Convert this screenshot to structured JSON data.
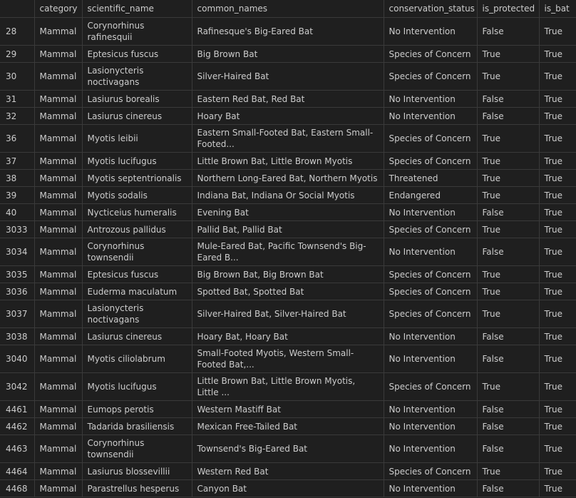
{
  "columns": [
    "",
    "category",
    "scientific_name",
    "common_names",
    "conservation_status",
    "is_protected",
    "is_bat"
  ],
  "rows": [
    {
      "index": "28",
      "category": "Mammal",
      "scientific_name": "Corynorhinus rafinesquii",
      "common_names": "Rafinesque's Big-Eared Bat",
      "conservation_status": "No Intervention",
      "is_protected": "False",
      "is_bat": "True"
    },
    {
      "index": "29",
      "category": "Mammal",
      "scientific_name": "Eptesicus fuscus",
      "common_names": "Big Brown Bat",
      "conservation_status": "Species of Concern",
      "is_protected": "True",
      "is_bat": "True"
    },
    {
      "index": "30",
      "category": "Mammal",
      "scientific_name": "Lasionycteris noctivagans",
      "common_names": "Silver-Haired Bat",
      "conservation_status": "Species of Concern",
      "is_protected": "True",
      "is_bat": "True"
    },
    {
      "index": "31",
      "category": "Mammal",
      "scientific_name": "Lasiurus borealis",
      "common_names": "Eastern Red Bat, Red Bat",
      "conservation_status": "No Intervention",
      "is_protected": "False",
      "is_bat": "True"
    },
    {
      "index": "32",
      "category": "Mammal",
      "scientific_name": "Lasiurus cinereus",
      "common_names": "Hoary Bat",
      "conservation_status": "No Intervention",
      "is_protected": "False",
      "is_bat": "True"
    },
    {
      "index": "36",
      "category": "Mammal",
      "scientific_name": "Myotis leibii",
      "common_names": "Eastern Small-Footed Bat, Eastern Small-Footed...",
      "conservation_status": "Species of Concern",
      "is_protected": "True",
      "is_bat": "True"
    },
    {
      "index": "37",
      "category": "Mammal",
      "scientific_name": "Myotis lucifugus",
      "common_names": "Little Brown Bat, Little Brown Myotis",
      "conservation_status": "Species of Concern",
      "is_protected": "True",
      "is_bat": "True"
    },
    {
      "index": "38",
      "category": "Mammal",
      "scientific_name": "Myotis septentrionalis",
      "common_names": "Northern Long-Eared Bat, Northern Myotis",
      "conservation_status": "Threatened",
      "is_protected": "True",
      "is_bat": "True"
    },
    {
      "index": "39",
      "category": "Mammal",
      "scientific_name": "Myotis sodalis",
      "common_names": "Indiana Bat, Indiana Or Social Myotis",
      "conservation_status": "Endangered",
      "is_protected": "True",
      "is_bat": "True"
    },
    {
      "index": "40",
      "category": "Mammal",
      "scientific_name": "Nycticeius humeralis",
      "common_names": "Evening Bat",
      "conservation_status": "No Intervention",
      "is_protected": "False",
      "is_bat": "True"
    },
    {
      "index": "3033",
      "category": "Mammal",
      "scientific_name": "Antrozous pallidus",
      "common_names": "Pallid Bat, Pallid Bat",
      "conservation_status": "Species of Concern",
      "is_protected": "True",
      "is_bat": "True"
    },
    {
      "index": "3034",
      "category": "Mammal",
      "scientific_name": "Corynorhinus townsendii",
      "common_names": "Mule-Eared Bat, Pacific Townsend's Big-Eared B...",
      "conservation_status": "No Intervention",
      "is_protected": "False",
      "is_bat": "True"
    },
    {
      "index": "3035",
      "category": "Mammal",
      "scientific_name": "Eptesicus fuscus",
      "common_names": "Big Brown Bat, Big Brown Bat",
      "conservation_status": "Species of Concern",
      "is_protected": "True",
      "is_bat": "True"
    },
    {
      "index": "3036",
      "category": "Mammal",
      "scientific_name": "Euderma maculatum",
      "common_names": "Spotted Bat, Spotted Bat",
      "conservation_status": "Species of Concern",
      "is_protected": "True",
      "is_bat": "True"
    },
    {
      "index": "3037",
      "category": "Mammal",
      "scientific_name": "Lasionycteris noctivagans",
      "common_names": "Silver-Haired Bat, Silver-Haired Bat",
      "conservation_status": "Species of Concern",
      "is_protected": "True",
      "is_bat": "True"
    },
    {
      "index": "3038",
      "category": "Mammal",
      "scientific_name": "Lasiurus cinereus",
      "common_names": "Hoary Bat, Hoary Bat",
      "conservation_status": "No Intervention",
      "is_protected": "False",
      "is_bat": "True"
    },
    {
      "index": "3040",
      "category": "Mammal",
      "scientific_name": "Myotis ciliolabrum",
      "common_names": "Small-Footed Myotis, Western Small-Footed Bat,...",
      "conservation_status": "No Intervention",
      "is_protected": "False",
      "is_bat": "True"
    },
    {
      "index": "3042",
      "category": "Mammal",
      "scientific_name": "Myotis lucifugus",
      "common_names": "Little Brown Bat, Little Brown Myotis, Little ...",
      "conservation_status": "Species of Concern",
      "is_protected": "True",
      "is_bat": "True"
    },
    {
      "index": "4461",
      "category": "Mammal",
      "scientific_name": "Eumops perotis",
      "common_names": "Western Mastiff Bat",
      "conservation_status": "No Intervention",
      "is_protected": "False",
      "is_bat": "True"
    },
    {
      "index": "4462",
      "category": "Mammal",
      "scientific_name": "Tadarida brasiliensis",
      "common_names": "Mexican Free-Tailed Bat",
      "conservation_status": "No Intervention",
      "is_protected": "False",
      "is_bat": "True"
    },
    {
      "index": "4463",
      "category": "Mammal",
      "scientific_name": "Corynorhinus townsendii",
      "common_names": "Townsend's Big-Eared Bat",
      "conservation_status": "No Intervention",
      "is_protected": "False",
      "is_bat": "True"
    },
    {
      "index": "4464",
      "category": "Mammal",
      "scientific_name": "Lasiurus blossevillii",
      "common_names": "Western Red Bat",
      "conservation_status": "Species of Concern",
      "is_protected": "True",
      "is_bat": "True"
    },
    {
      "index": "4468",
      "category": "Mammal",
      "scientific_name": "Parastrellus hesperus",
      "common_names": "Canyon Bat",
      "conservation_status": "No Intervention",
      "is_protected": "False",
      "is_bat": "True"
    }
  ]
}
